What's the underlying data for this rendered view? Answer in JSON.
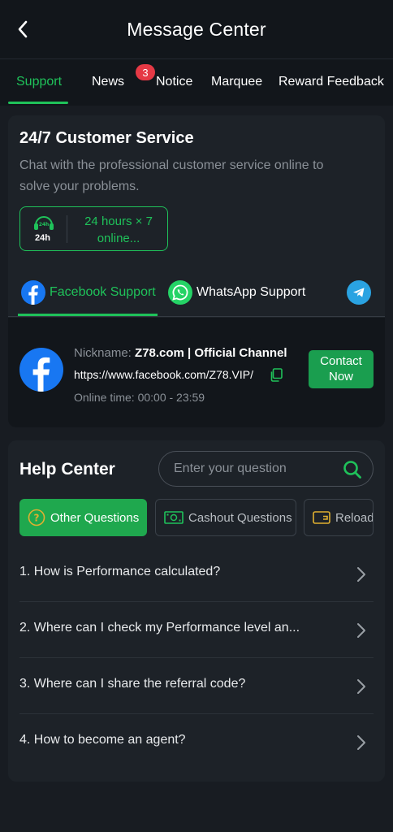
{
  "header": {
    "title": "Message Center"
  },
  "tabs": [
    {
      "label": "Support",
      "active": true
    },
    {
      "label": "News"
    },
    {
      "label": "Notice",
      "badge": "3"
    },
    {
      "label": "Marquee"
    },
    {
      "label": "Reward Feedback"
    }
  ],
  "customer_service": {
    "title": "24/7 Customer Service",
    "description": "Chat with the professional customer service online to solve your problems.",
    "hours_icon_label": "24h",
    "hours_text": "24 hours × 7 online..."
  },
  "support_tabs": [
    {
      "label": "Facebook Support",
      "icon": "facebook-icon",
      "active": true
    },
    {
      "label": "WhatsApp Support",
      "icon": "whatsapp-icon"
    },
    {
      "label": "",
      "icon": "telegram-icon"
    }
  ],
  "facebook": {
    "nickname_label": "Nickname: ",
    "nickname": "Z78.com | Official Channel",
    "url": "https://www.facebook.com/Z78.VIP/",
    "online_time": "Online time: 00:00 - 23:59",
    "contact_label": "Contact Now"
  },
  "help": {
    "title": "Help Center",
    "search_placeholder": "Enter your question",
    "categories": [
      {
        "label": "Other Questions",
        "icon": "question-icon",
        "active": true
      },
      {
        "label": "Cashout Questions",
        "icon": "cash-icon"
      },
      {
        "label": "Reload",
        "icon": "wallet-icon"
      }
    ],
    "questions": [
      "1. How is Performance calculated?",
      "2. Where can I check my Performance level an...",
      "3. Where can I share the referral code?",
      "4. How to become an agent?"
    ]
  },
  "colors": {
    "accent": "#1fc25a",
    "badge": "#e53945",
    "background": "#181c22"
  }
}
